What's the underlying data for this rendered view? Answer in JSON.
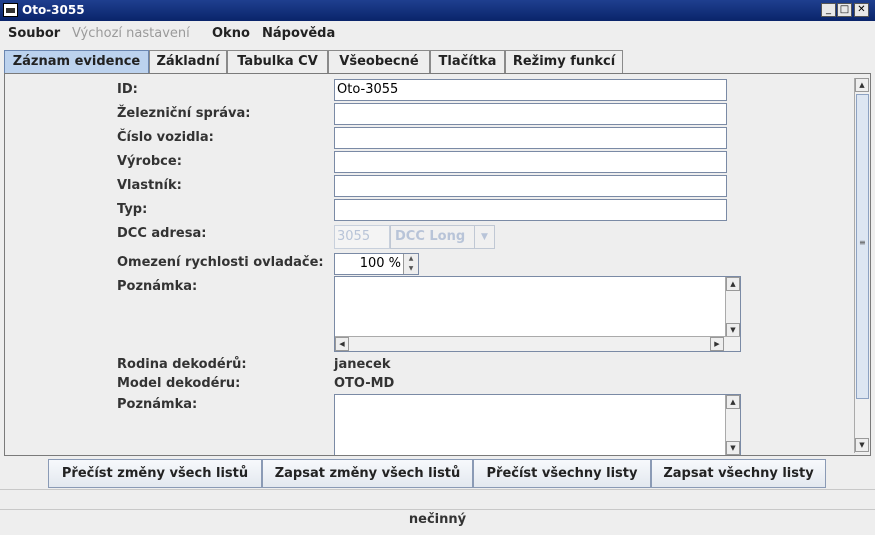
{
  "window": {
    "title": "Oto-3055"
  },
  "menu": [
    "Soubor",
    "Výchozí nastavení",
    "Okno",
    "Nápověda"
  ],
  "tabs": [
    "Záznam evidence",
    "Základní",
    "Tabulka CV",
    "Všeobecné",
    "Tlačítka",
    "Režimy funkcí"
  ],
  "form": {
    "id_label": "ID:",
    "id_value": "Oto-3055",
    "railroad_label": "Železniční správa:",
    "railroad_value": "",
    "number_label": "Číslo vozidla:",
    "number_value": "",
    "manufacturer_label": "Výrobce:",
    "manufacturer_value": "",
    "owner_label": "Vlastník:",
    "owner_value": "",
    "type_label": "Typ:",
    "type_value": "",
    "dcc_label": "DCC adresa:",
    "dcc_value": "3055",
    "dcc_mode": "DCC Long",
    "speed_label": "Omezení rychlosti ovladače:",
    "speed_value": "100 %",
    "comment_label": "Poznámka:",
    "comment_value": "",
    "decoder_family_label": "Rodina dekodérů:",
    "decoder_family_value": "janecek",
    "decoder_model_label": "Model dekodéru:",
    "decoder_model_value": "OTO-MD",
    "decoder_comment_label": "Poznámka:",
    "decoder_comment_value": ""
  },
  "buttons": [
    "Přečíst změny všech listů",
    "Zapsat změny všech listů",
    "Přečíst všechny listy",
    "Zapsat všechny listy"
  ],
  "status": "nečinný",
  "colors": {
    "title_bar": "#0a246a",
    "active_tab": "#bcd2ee",
    "disabled_text": "#b8c4d8"
  }
}
